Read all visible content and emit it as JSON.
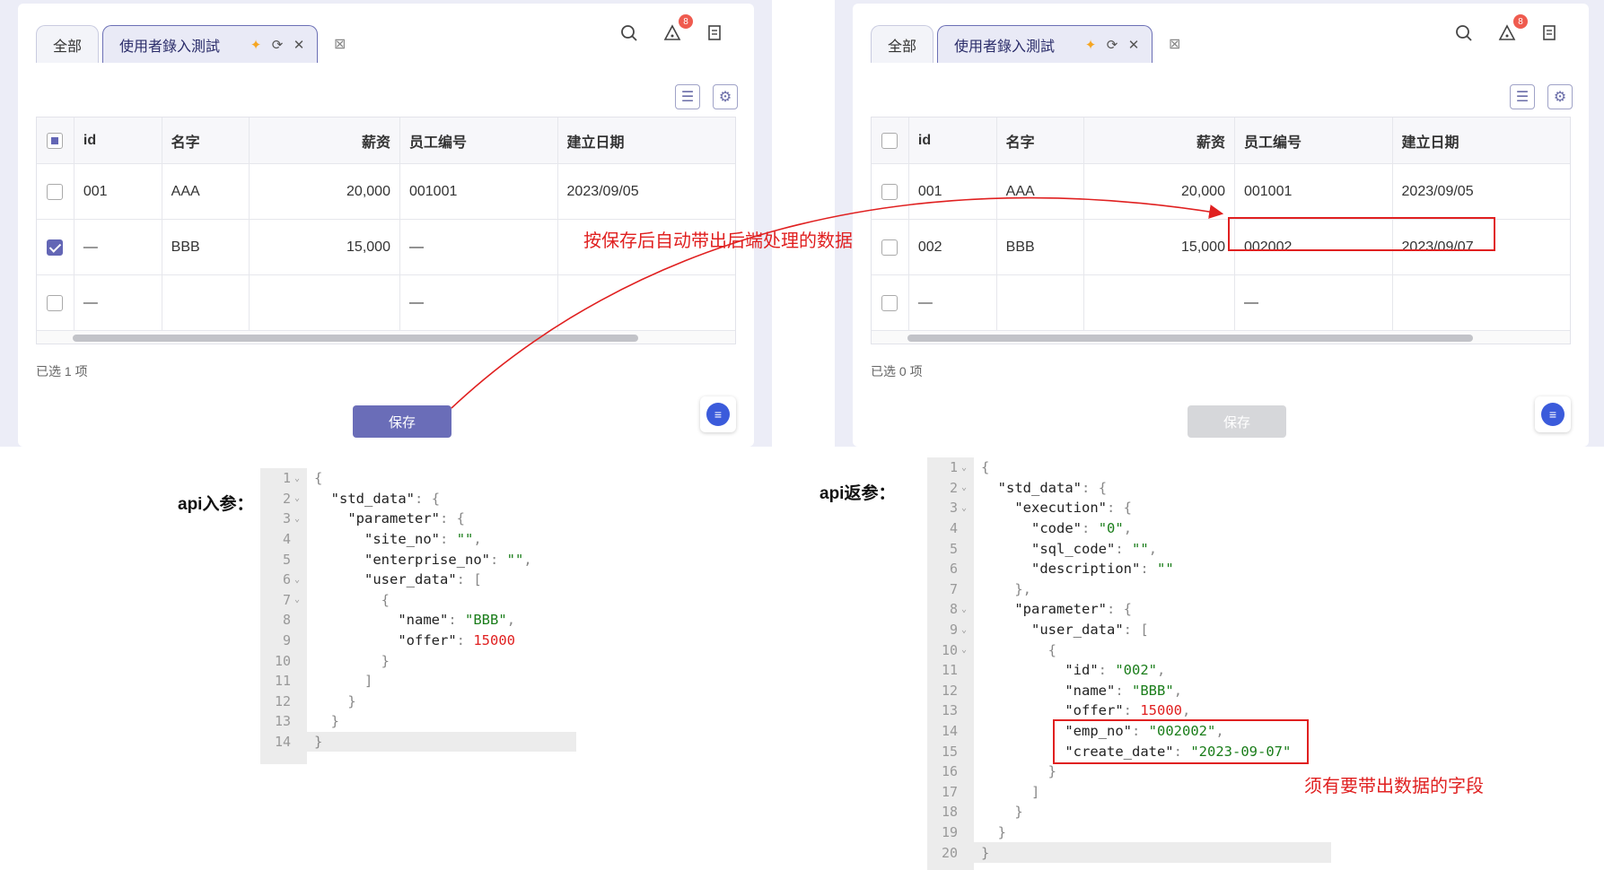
{
  "left_screen": {
    "tabs": [
      "全部",
      "使用者錄入測試"
    ],
    "badge": "8",
    "columns": [
      "id",
      "名字",
      "薪资",
      "员工编号",
      "建立日期"
    ],
    "rows": [
      {
        "id": "001",
        "name": "AAA",
        "offer": "20,000",
        "emp": "001001",
        "date": "2023/09/05",
        "checked": false
      },
      {
        "id": "—",
        "name": "BBB",
        "offer": "15,000",
        "emp": "—",
        "date": "",
        "checked": true
      },
      {
        "id": "—",
        "name": "",
        "offer": "",
        "emp": "—",
        "date": "",
        "checked": false
      }
    ],
    "selected": "已选 1 项",
    "save": "保存"
  },
  "right_screen": {
    "tabs": [
      "全部",
      "使用者錄入測試"
    ],
    "badge": "8",
    "columns": [
      "id",
      "名字",
      "薪资",
      "员工编号",
      "建立日期"
    ],
    "rows": [
      {
        "id": "001",
        "name": "AAA",
        "offer": "20,000",
        "emp": "001001",
        "date": "2023/09/05",
        "checked": false
      },
      {
        "id": "002",
        "name": "BBB",
        "offer": "15,000",
        "emp": "002002",
        "date": "2023/09/07",
        "checked": false
      },
      {
        "id": "—",
        "name": "",
        "offer": "",
        "emp": "—",
        "date": "",
        "checked": false
      }
    ],
    "selected": "已选 0 项",
    "save": "保存"
  },
  "annotations": {
    "arrow_text": "按保存后自动带出后端处理的数据",
    "fields_note": "须有要带出数据的字段",
    "api_in_label": "api入参：",
    "api_out_label": "api返参："
  },
  "code_in": [
    "{",
    "  \"std_data\": {",
    "    \"parameter\": {",
    "      \"site_no\": \"\",",
    "      \"enterprise_no\": \"\",",
    "      \"user_data\": [",
    "        {",
    "          \"name\": \"BBB\",",
    "          \"offer\": 15000",
    "        }",
    "      ]",
    "    }",
    "  }",
    "}"
  ],
  "code_out": [
    "{",
    "  \"std_data\": {",
    "    \"execution\": {",
    "      \"code\": \"0\",",
    "      \"sql_code\": \"\",",
    "      \"description\": \"\"",
    "    },",
    "    \"parameter\": {",
    "      \"user_data\": [",
    "        {",
    "          \"id\": \"002\",",
    "          \"name\": \"BBB\",",
    "          \"offer\": 15000,",
    "          \"emp_no\": \"002002\",",
    "          \"create_date\": \"2023-09-07\"",
    "        }",
    "      ]",
    "    }",
    "  }",
    "}"
  ]
}
